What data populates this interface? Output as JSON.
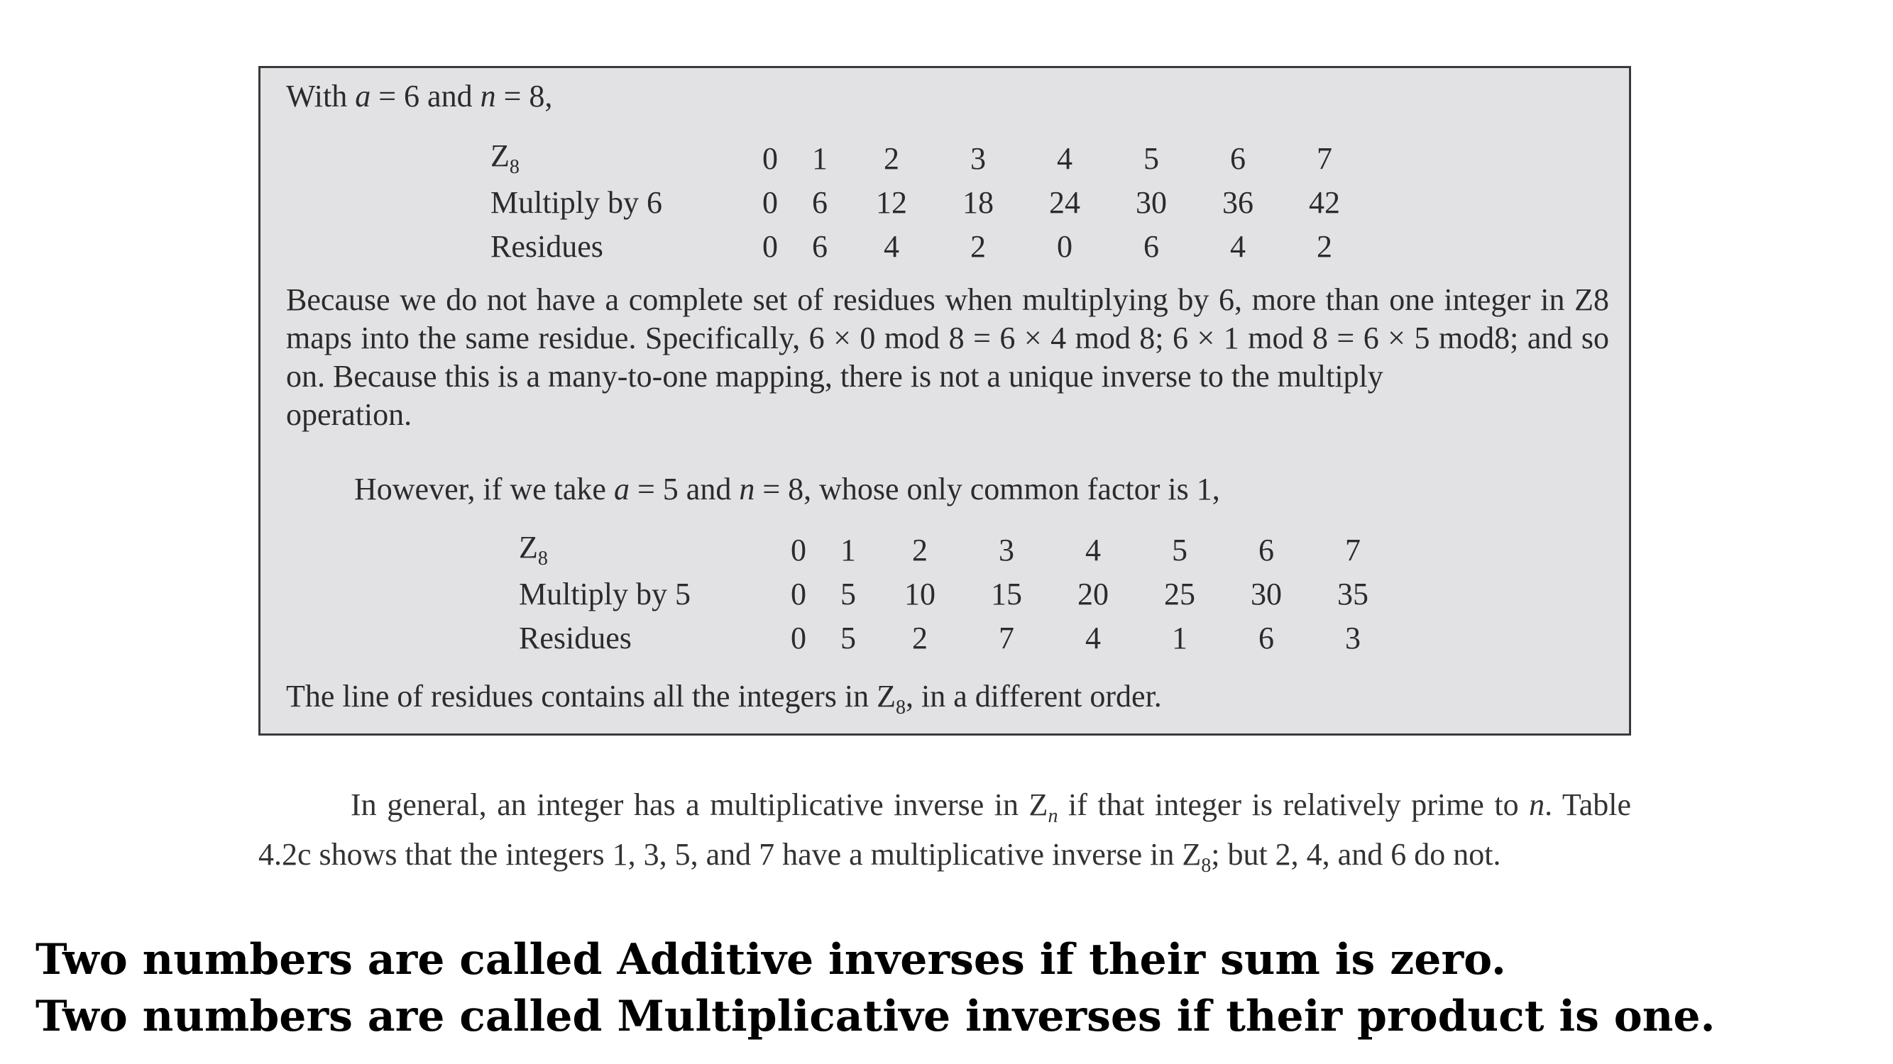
{
  "box": {
    "intro_prefix": "With ",
    "intro_a": "a",
    "intro_mid": " = 6 and ",
    "intro_n": "n",
    "intro_suffix": " = 8,",
    "table1": {
      "rows": [
        {
          "label": "Z",
          "label_sub": "8",
          "values": [
            "0",
            "1",
            "2",
            "3",
            "4",
            "5",
            "6",
            "7"
          ]
        },
        {
          "label": "Multiply by 6",
          "label_sub": "",
          "values": [
            "0",
            "6",
            "12",
            "18",
            "24",
            "30",
            "36",
            "42"
          ]
        },
        {
          "label": "Residues",
          "label_sub": "",
          "values": [
            "0",
            "6",
            "4",
            "2",
            "0",
            "6",
            "4",
            "2"
          ]
        }
      ]
    },
    "paragraph": "Because we do not have a complete set of residues when multiplying by 6, more than one integer in Z8 maps into the same residue. Specifically, 6 × 0 mod 8 = 6 × 4 mod 8; 6 × 1 mod 8 = 6 × 5 mod8; and so on. Because this is a many-to-one mapping, there is not a unique inverse to the multiply",
    "paragraph_last": "operation.",
    "however_prefix": "However, if we take ",
    "however_a": "a",
    "however_mid": " = 5 and ",
    "however_n": "n",
    "however_suffix": " = 8, whose only common factor is 1,",
    "table2": {
      "rows": [
        {
          "label": "Z",
          "label_sub": "8",
          "values": [
            "0",
            "1",
            "2",
            "3",
            "4",
            "5",
            "6",
            "7"
          ]
        },
        {
          "label": "Multiply by 5",
          "label_sub": "",
          "values": [
            "0",
            "5",
            "10",
            "15",
            "20",
            "25",
            "30",
            "35"
          ]
        },
        {
          "label": "Residues",
          "label_sub": "",
          "values": [
            "0",
            "5",
            "2",
            "7",
            "4",
            "1",
            "6",
            "3"
          ]
        }
      ]
    },
    "closing_prefix": "The line of residues contains all the integers in Z",
    "closing_sub": "8",
    "closing_suffix": ", in a different order."
  },
  "general": {
    "part1": "In general, an integer has a multiplicative inverse in Z",
    "part1_sub": "n",
    "part2": " if that integer is relatively prime to ",
    "part2_n": "n",
    "part3": ". Table 4.2c shows that the integers 1, 3, 5, and 7 have a multiplicative inverse in Z",
    "part3_sub": "8",
    "part4": "; but 2, 4, and 6 do not."
  },
  "definitions": {
    "additive": "Two numbers are called Additive inverses if their sum is zero.",
    "multiplicative": "Two numbers are called Multiplicative inverses if their product is one."
  }
}
